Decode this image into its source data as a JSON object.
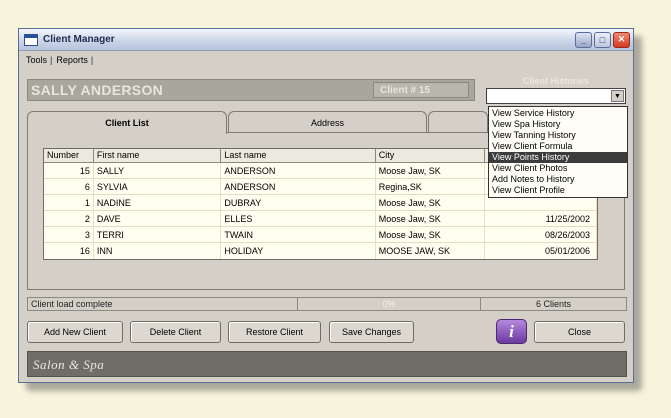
{
  "window": {
    "title": "Client Manager",
    "buttons": {
      "minimize": "_",
      "maximize": "□",
      "close": "✕"
    }
  },
  "menu": [
    {
      "label": "Tools"
    },
    {
      "label": "Reports"
    }
  ],
  "menu_separator": "|",
  "header": {
    "client_name": "SALLY ANDERSON",
    "client_number": "Client # 15"
  },
  "histories": {
    "label": "Client Histories",
    "value": "",
    "options": [
      {
        "label": "View Service History",
        "selected": false
      },
      {
        "label": "View Spa History",
        "selected": false
      },
      {
        "label": "View Tanning History",
        "selected": false
      },
      {
        "label": "View Client Formula",
        "selected": false
      },
      {
        "label": "View Points History",
        "selected": true
      },
      {
        "label": "View Client Photos",
        "selected": false
      },
      {
        "label": "Add Notes to History",
        "selected": false
      },
      {
        "label": "View Client Profile",
        "selected": false
      }
    ]
  },
  "tabs": [
    {
      "label": "Client List",
      "active": true
    },
    {
      "label": "Address",
      "active": false
    },
    {
      "label": "",
      "active": false
    }
  ],
  "table": {
    "columns": [
      "Number",
      "First name",
      "Last name",
      "City",
      ""
    ],
    "rows": [
      {
        "number": "15",
        "first": "SALLY",
        "last": "ANDERSON",
        "city": "Moose Jaw, SK",
        "date": ""
      },
      {
        "number": "6",
        "first": "SYLVIA",
        "last": "ANDERSON",
        "city": "Regina,SK",
        "date": ""
      },
      {
        "number": "1",
        "first": "NADINE",
        "last": "DUBRAY",
        "city": "Moose Jaw, SK",
        "date": ""
      },
      {
        "number": "2",
        "first": "DAVE",
        "last": "ELLES",
        "city": "Moose Jaw, SK",
        "date": "11/25/2002"
      },
      {
        "number": "3",
        "first": "TERRI",
        "last": "TWAIN",
        "city": "Moose Jaw, SK",
        "date": "08/26/2003"
      },
      {
        "number": "16",
        "first": "INN",
        "last": "HOLIDAY",
        "city": "MOOSE JAW, SK",
        "date": "05/01/2006"
      }
    ]
  },
  "status": {
    "message": "Client load complete",
    "progress": "0%",
    "count": "6 Clients"
  },
  "buttons": {
    "add": "Add New Client",
    "delete": "Delete Client",
    "restore": "Restore Client",
    "save": "Save Changes",
    "info": "i",
    "close": "Close"
  },
  "footer": {
    "brand": "Salon & Spa"
  },
  "colors": {
    "background": "#f7f4dc",
    "window": "#d4d0c8",
    "header": "#a9a69b",
    "info_button": "#8a55c0",
    "footer": "#6f6d68"
  }
}
